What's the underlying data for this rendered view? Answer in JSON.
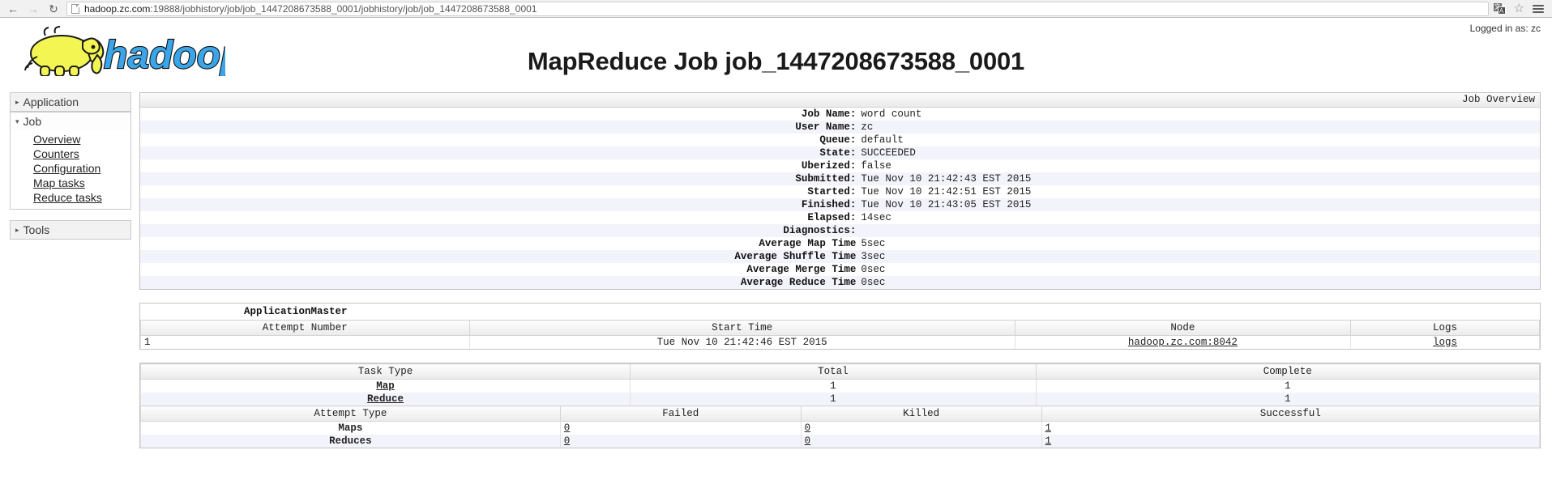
{
  "browser": {
    "back_icon": "back-arrow-icon",
    "forward_icon": "forward-arrow-icon",
    "reload_icon": "reload-icon",
    "url_host": "hadoop.zc.com",
    "url_rest": ":19888/jobhistory/job/job_1447208673588_0001/jobhistory/job/job_1447208673588_0001",
    "translate_icon": "translate-icon",
    "bookmark_icon": "star-icon",
    "menu_icon": "hamburger-menu-icon"
  },
  "header": {
    "logo_text": "hadoop",
    "title": "MapReduce Job job_1447208673588_0001",
    "logged_in": "Logged in as: zc"
  },
  "sidebar": {
    "application_label": "Application",
    "job_label": "Job",
    "tools_label": "Tools",
    "collapsed_marker": "▸",
    "expanded_marker": "▾",
    "job_links": [
      {
        "label": "Overview"
      },
      {
        "label": "Counters"
      },
      {
        "label": "Configuration"
      },
      {
        "label": "Map tasks"
      },
      {
        "label": "Reduce tasks"
      }
    ]
  },
  "overview": {
    "caption": "Job Overview",
    "rows": [
      {
        "key": "Job Name:",
        "value": "word count"
      },
      {
        "key": "User Name:",
        "value": "zc"
      },
      {
        "key": "Queue:",
        "value": "default"
      },
      {
        "key": "State:",
        "value": "SUCCEEDED"
      },
      {
        "key": "Uberized:",
        "value": "false"
      },
      {
        "key": "Submitted:",
        "value": "Tue Nov 10 21:42:43 EST 2015"
      },
      {
        "key": "Started:",
        "value": "Tue Nov 10 21:42:51 EST 2015"
      },
      {
        "key": "Finished:",
        "value": "Tue Nov 10 21:43:05 EST 2015"
      },
      {
        "key": "Elapsed:",
        "value": "14sec"
      },
      {
        "key": "Diagnostics:",
        "value": ""
      },
      {
        "key": "Average Map Time",
        "value": "5sec"
      },
      {
        "key": "Average Shuffle Time",
        "value": "3sec"
      },
      {
        "key": "Average Merge Time",
        "value": "0sec"
      },
      {
        "key": "Average Reduce Time",
        "value": "0sec"
      }
    ]
  },
  "application_master": {
    "title": "ApplicationMaster",
    "headers": [
      "Attempt Number",
      "Start Time",
      "Node",
      "Logs"
    ],
    "row": {
      "attempt_number": "1",
      "start_time": "Tue Nov 10 21:42:46 EST 2015",
      "node": "hadoop.zc.com:8042",
      "logs": "logs"
    }
  },
  "task_table": {
    "headers": [
      "Task Type",
      "Total",
      "Complete"
    ],
    "rows": [
      {
        "type": "Map",
        "total": "1",
        "complete": "1"
      },
      {
        "type": "Reduce",
        "total": "1",
        "complete": "1"
      }
    ]
  },
  "attempt_table": {
    "headers": [
      "Attempt Type",
      "Failed",
      "Killed",
      "Successful"
    ],
    "rows": [
      {
        "type": "Maps",
        "failed": "0",
        "killed": "0",
        "successful": "1"
      },
      {
        "type": "Reduces",
        "failed": "0",
        "killed": "0",
        "successful": "1"
      }
    ]
  }
}
